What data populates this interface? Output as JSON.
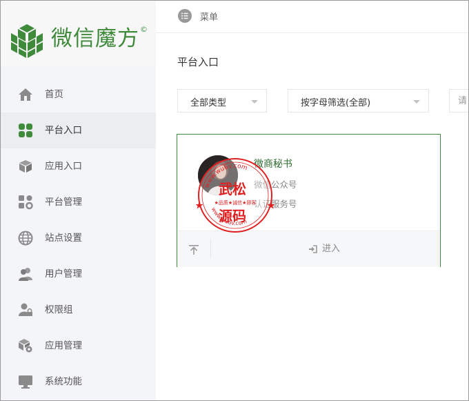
{
  "brand": {
    "name": "微信魔方",
    "reg_mark": "©"
  },
  "topbar": {
    "menu_label": "菜单"
  },
  "sidebar": {
    "items": [
      {
        "label": "首页",
        "icon": "home-icon",
        "active": false
      },
      {
        "label": "平台入口",
        "icon": "grid-icon",
        "active": true
      },
      {
        "label": "应用入口",
        "icon": "cube-icon",
        "active": false
      },
      {
        "label": "平台管理",
        "icon": "manage-grid-icon",
        "active": false
      },
      {
        "label": "站点设置",
        "icon": "globe-icon",
        "active": false
      },
      {
        "label": "用户管理",
        "icon": "users-icon",
        "active": false
      },
      {
        "label": "权限组",
        "icon": "user-lock-icon",
        "active": false
      },
      {
        "label": "应用管理",
        "icon": "cube-gear-icon",
        "active": false
      },
      {
        "label": "系统功能",
        "icon": "monitor-icon",
        "active": false
      }
    ]
  },
  "main": {
    "title": "平台入口",
    "filters": {
      "type_value": "全部类型",
      "letter_value": "按字母筛选(全部)",
      "search_placeholder": "请"
    },
    "card": {
      "name": "微商秘书",
      "type": "微信公众号",
      "level": "认证服务号",
      "enter_label": "进入"
    }
  },
  "watermark": {
    "top_url": "www.wu6v.com",
    "line1": "武松",
    "slogan": "★品质★诚信★顾客",
    "line2": "源码",
    "bottom_url": "www.wu6v.com"
  },
  "colors": {
    "brand_green": "#3f8a3b",
    "card_border": "#3c8d3f",
    "stamp_red": "#e02020"
  }
}
